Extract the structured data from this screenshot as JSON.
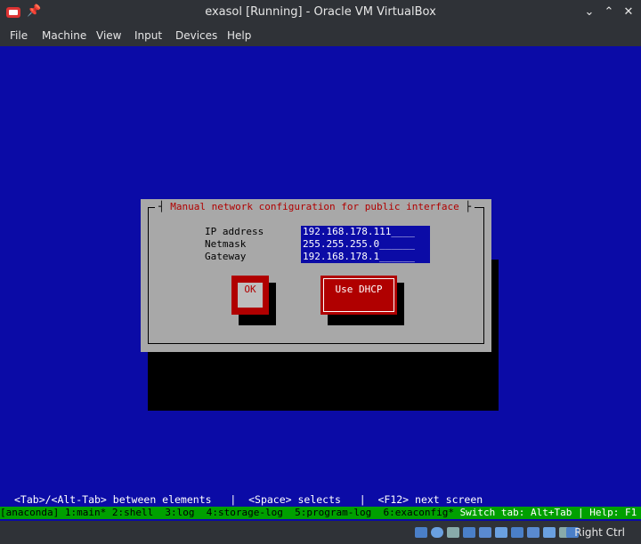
{
  "window": {
    "title": "exasol [Running] - Oracle VM VirtualBox",
    "pin_glyph": "📌",
    "minimize_glyph": "⌄",
    "maximize_glyph": "⌃",
    "close_glyph": "✕"
  },
  "menu": {
    "items": [
      "File",
      "Machine",
      "View",
      "Input",
      "Devices",
      "Help"
    ]
  },
  "dialog": {
    "title": "Manual network configuration for public interface",
    "fields": [
      {
        "label": "IP address",
        "value": "192.168.178.111____"
      },
      {
        "label": "Netmask",
        "value": "255.255.255.0______"
      },
      {
        "label": "Gateway",
        "value": "192.168.178.1______"
      }
    ],
    "ok_label": "OK",
    "dhcp_label": "Use DHCP"
  },
  "terminal": {
    "hint": "<Tab>/<Alt-Tab> between elements   |  <Space> selects   |  <F12> next screen",
    "tmux": {
      "tabs": "[anaconda] 1:main* 2:shell  3:log  4:storage-log  5:program-log  6:exaconfig* ",
      "help": "Switch tab: Alt+Tab | Help: F1"
    }
  },
  "statusbar": {
    "host_key": "Right Ctrl",
    "icon_names": [
      "hard-disk-icon",
      "optical-drive-icon",
      "audio-icon",
      "network-icon",
      "usb-icon",
      "shared-folder-icon",
      "display-icon",
      "video-capture-icon",
      "cpu-icon",
      "mouse-integration-icon",
      "keyboard-icon"
    ]
  },
  "colors": {
    "vm_background": "#0b0ba6",
    "dialog": "#a8a8a8",
    "accent_red": "#b00000",
    "tmux_green": "#00a000"
  }
}
